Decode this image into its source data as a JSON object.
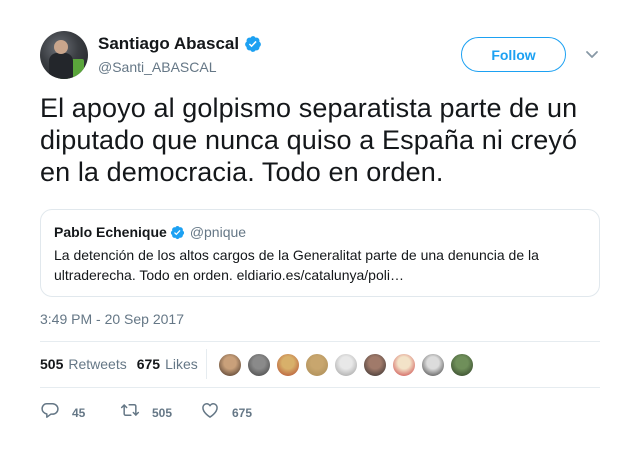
{
  "author": {
    "display_name": "Santiago Abascal",
    "handle": "@Santi_ABASCAL",
    "verified": true
  },
  "follow_button": {
    "label": "Follow"
  },
  "tweet": {
    "text": "El apoyo al golpismo separatista parte de un diputado que nunca quiso a España ni creyó en la democracia. Todo en orden."
  },
  "quoted_tweet": {
    "display_name": "Pablo Echenique",
    "handle": "@pnique",
    "verified": true,
    "text": "La detención de los altos cargos de la Generalitat parte de una denuncia de la ultraderecha. Todo en orden. eldiario.es/catalunya/poli…"
  },
  "timestamp": "3:49 PM - 20 Sep 2017",
  "stats": {
    "retweets_count": "505",
    "retweets_label": "Retweets",
    "likes_count": "675",
    "likes_label": "Likes"
  },
  "liker_avatars": [
    {
      "colors": [
        "#c9a07a",
        "#3b2a20"
      ]
    },
    {
      "colors": [
        "#8a8a8a",
        "#3d3d3d"
      ]
    },
    {
      "colors": [
        "#d8b06a",
        "#b0452d"
      ]
    },
    {
      "colors": [
        "#c8a66e",
        "#a88a55"
      ]
    },
    {
      "colors": [
        "#e8e8e8",
        "#9a9a9a"
      ]
    },
    {
      "colors": [
        "#a07a6a",
        "#2d2a2a"
      ]
    },
    {
      "colors": [
        "#f3e3c8",
        "#c7343a"
      ]
    },
    {
      "colors": [
        "#dcdcdc",
        "#333333"
      ]
    },
    {
      "colors": [
        "#6f8f5a",
        "#2a3a22"
      ]
    }
  ],
  "actions": {
    "reply_count": "45",
    "retweet_count": "505",
    "like_count": "675"
  },
  "colors": {
    "accent": "#1da1f2",
    "secondary_text": "#657786",
    "border": "#e1e8ed"
  },
  "icons": {
    "verified": "verified-badge-icon",
    "caret": "chevron-down-icon",
    "reply": "reply-icon",
    "retweet": "retweet-icon",
    "like": "heart-icon"
  }
}
